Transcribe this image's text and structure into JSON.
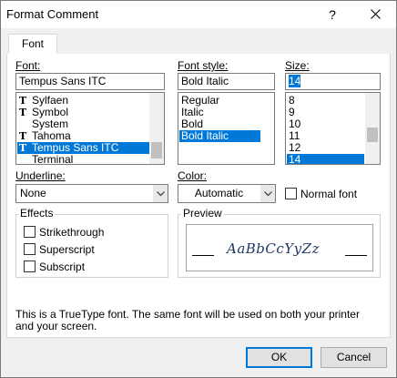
{
  "window": {
    "title": "Format Comment",
    "help_glyph": "?"
  },
  "tabs": [
    {
      "label": "Font"
    }
  ],
  "font": {
    "label": "Font:",
    "value": "Tempus Sans ITC",
    "tt_glyph": "T",
    "items": [
      "Sylfaen",
      "Symbol",
      "System",
      "Tahoma",
      "Tempus Sans ITC",
      "Terminal"
    ],
    "selected": "Tempus Sans ITC"
  },
  "font_style": {
    "label": "Font style:",
    "value": "Bold Italic",
    "items": [
      "Regular",
      "Italic",
      "Bold",
      "Bold Italic"
    ],
    "selected": "Bold Italic"
  },
  "size": {
    "label": "Size:",
    "value": "14",
    "items": [
      "8",
      "9",
      "10",
      "11",
      "12",
      "14"
    ],
    "selected": "14"
  },
  "underline": {
    "label": "Underline:",
    "value": "None"
  },
  "color": {
    "label": "Color:",
    "value": "Automatic"
  },
  "normal_font": {
    "label": "Normal font",
    "checked": false
  },
  "effects": {
    "title": "Effects",
    "strikethrough": "Strikethrough",
    "superscript": "Superscript",
    "subscript": "Subscript"
  },
  "preview": {
    "title": "Preview",
    "sample": "AaBbCcYyZz"
  },
  "info_text": "This is a TrueType font.  The same font will be used on both your printer and your screen.",
  "buttons": {
    "ok": "OK",
    "cancel": "Cancel"
  }
}
